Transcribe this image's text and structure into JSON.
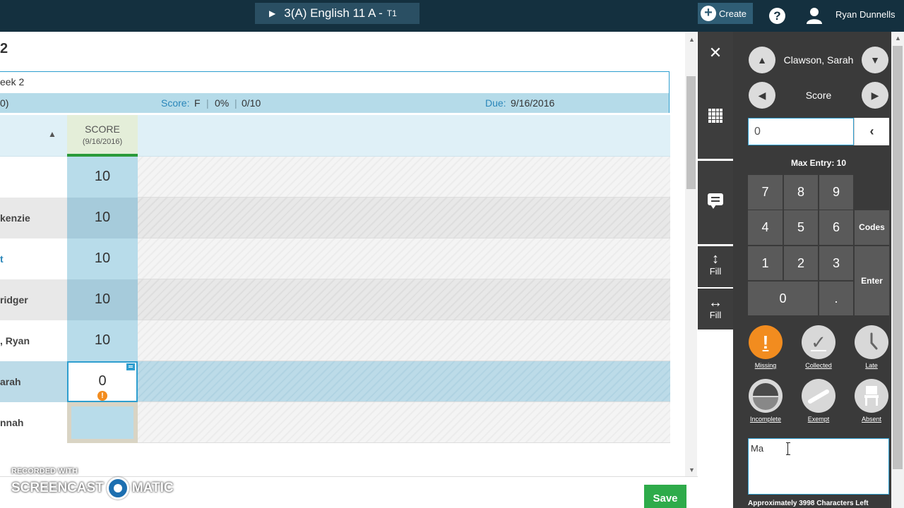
{
  "header": {
    "class_play_icon": "play-icon",
    "class_title": "3(A) English 11 A -",
    "class_term": "T1",
    "create_label": "Create",
    "help_label": "?",
    "user_name": "Ryan Dunnells"
  },
  "page": {
    "title_fragment": "2"
  },
  "assignment": {
    "name": "eek 2",
    "points_fragment": "0)",
    "score_label": "Score:",
    "score_grade": "F",
    "score_sep": "|",
    "score_percent": "0%",
    "score_points": "0/10",
    "due_label": "Due:",
    "due_date": "9/16/2016"
  },
  "grid": {
    "sort_icon": "▲",
    "score_header": "SCORE",
    "score_header_date": "(9/16/2016)",
    "rows": [
      {
        "name": "",
        "score": "10"
      },
      {
        "name": "kenzie",
        "score": "10"
      },
      {
        "name": "t",
        "score": "10"
      },
      {
        "name": "ridger",
        "score": "10"
      },
      {
        "name": ", Ryan",
        "score": "10"
      },
      {
        "name": "arah",
        "score": "0",
        "warning_icon": "!"
      },
      {
        "name": "nnah",
        "score": ""
      }
    ]
  },
  "footer": {
    "save_label": "Save",
    "watermark_top": "RECORDED WITH",
    "watermark_left": "SCREENCAST",
    "watermark_right": "MATIC"
  },
  "toolbar": {
    "close": "✕",
    "fill_vertical_arrow": "↕",
    "fill_vertical_label": "Fill",
    "fill_horizontal_arrow": "↔",
    "fill_horizontal_label": "Fill"
  },
  "panel": {
    "student_name": "Clawson, Sarah",
    "up_glyph": "▲",
    "down_glyph": "▼",
    "left_glyph": "◀",
    "right_glyph": "▶",
    "field_label": "Score",
    "input_value": "0",
    "backspace_glyph": "‹",
    "max_entry": "Max Entry: 10",
    "keys": {
      "k7": "7",
      "k8": "8",
      "k9": "9",
      "k4": "4",
      "k5": "5",
      "k6": "6",
      "k1": "1",
      "k2": "2",
      "k3": "3",
      "k0": "0",
      "dot": ".",
      "codes": "Codes",
      "enter": "Enter"
    },
    "status": {
      "missing_icon": "!",
      "missing": "Missing",
      "collected_icon": "✓",
      "collected": "Collected",
      "late": "Late",
      "incomplete": "Incomplete",
      "exempt": "Exempt",
      "absent": "Absent"
    },
    "comment_value": "Ma",
    "chars_left": "Approximately 3998 Characters Left"
  }
}
